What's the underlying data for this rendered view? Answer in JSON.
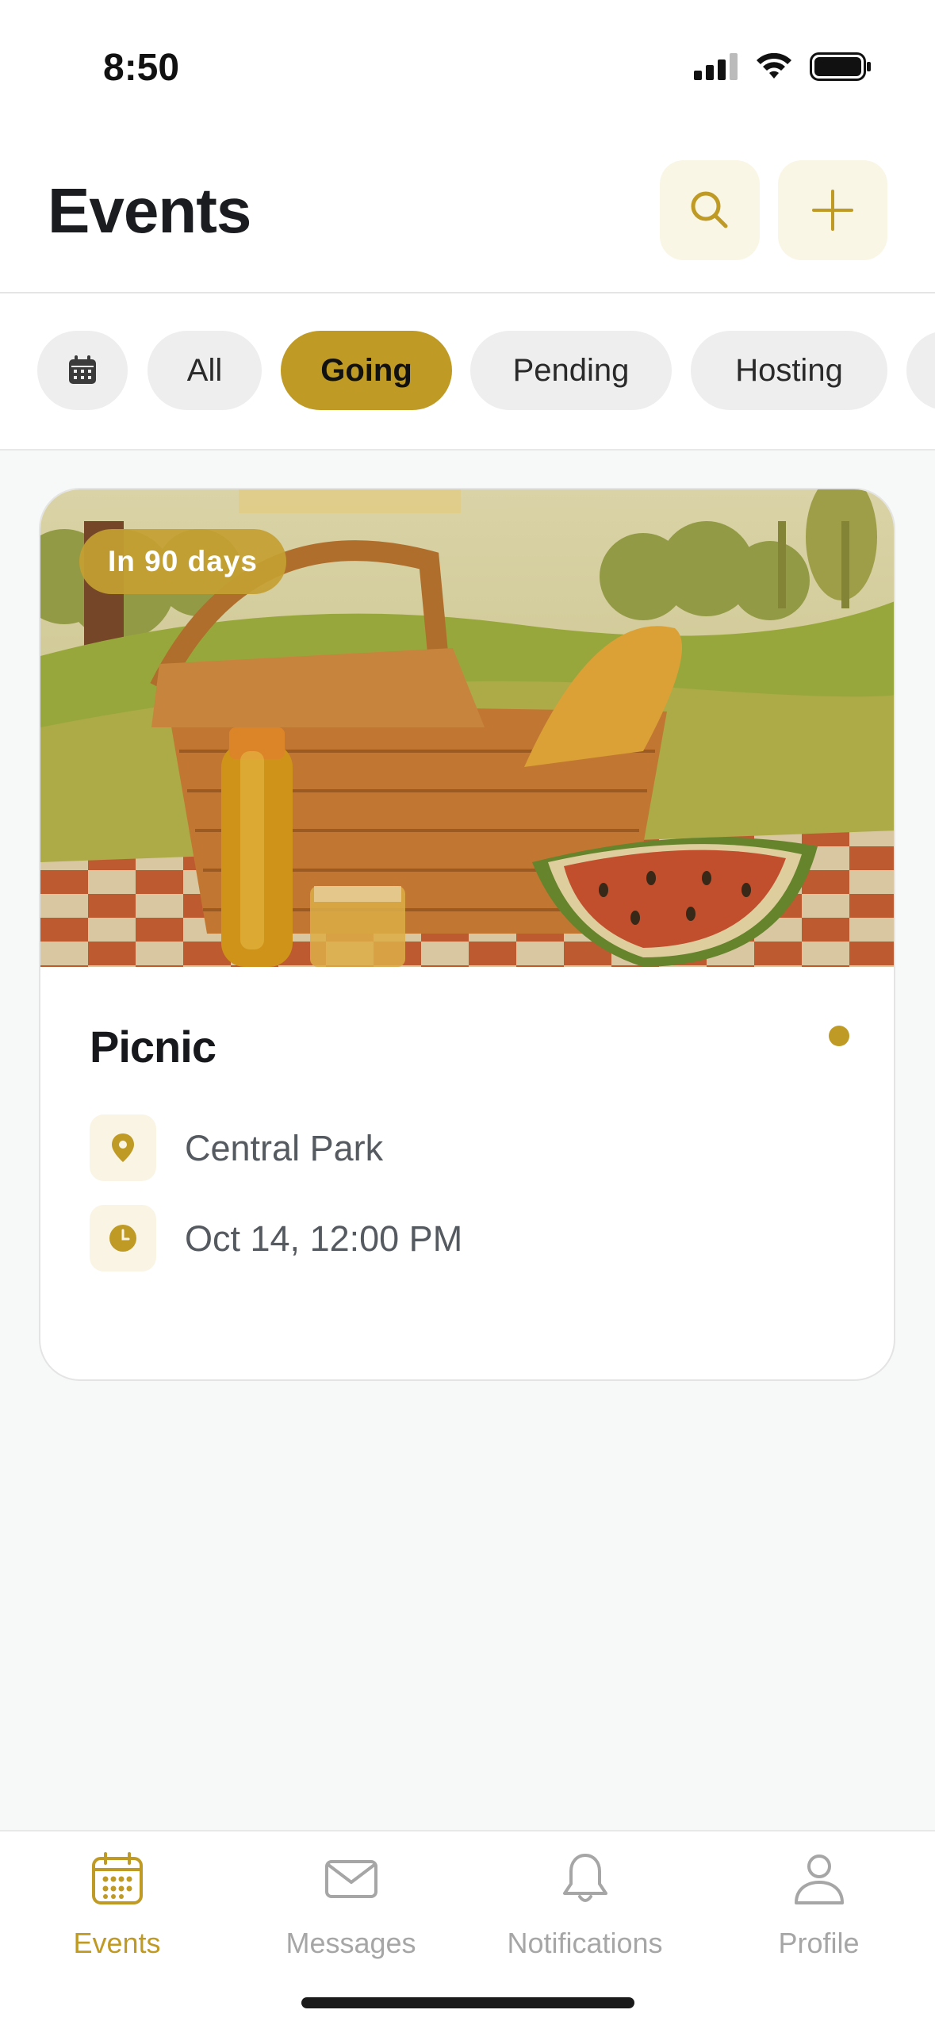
{
  "status": {
    "time": "8:50"
  },
  "header": {
    "title": "Events"
  },
  "filters": {
    "items": [
      {
        "label": "All",
        "active": false
      },
      {
        "label": "Going",
        "active": true
      },
      {
        "label": "Pending",
        "active": false
      },
      {
        "label": "Hosting",
        "active": false
      }
    ]
  },
  "event": {
    "badge": "In 90 days",
    "title": "Picnic",
    "location": "Central Park",
    "datetime": "Oct 14, 12:00 PM"
  },
  "tabs": [
    {
      "label": "Events",
      "icon": "calendar-icon",
      "active": true
    },
    {
      "label": "Messages",
      "icon": "envelope-icon",
      "active": false
    },
    {
      "label": "Notifications",
      "icon": "bell-icon",
      "active": false
    },
    {
      "label": "Profile",
      "icon": "person-icon",
      "active": false
    }
  ],
  "colors": {
    "accent": "#bf9b25",
    "accent_soft": "#faf6e6",
    "muted": "#a6a6a6"
  }
}
